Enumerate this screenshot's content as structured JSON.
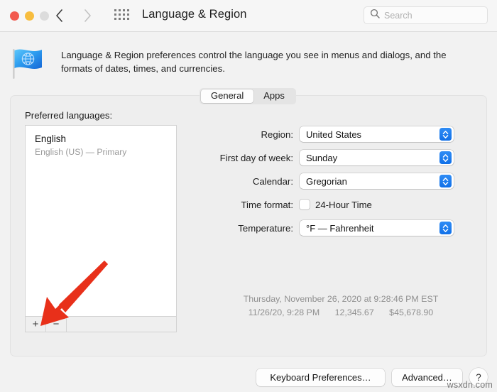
{
  "window": {
    "title": "Language & Region",
    "traffic_lights": [
      "close-red",
      "minimize-yellow",
      "zoom-gray-disabled"
    ],
    "back_icon": "chevron-left-icon",
    "forward_icon": "chevron-right-icon",
    "grid_icon": "show-all-grid-icon"
  },
  "search": {
    "placeholder": "Search",
    "icon": "search-icon",
    "value": ""
  },
  "header": {
    "icon": "flag-globe-icon",
    "description": "Language & Region preferences control the language you see in menus and dialogs, and the formats of dates, times, and currencies."
  },
  "tabs": [
    {
      "label": "General",
      "active": true
    },
    {
      "label": "Apps",
      "active": false
    }
  ],
  "languages": {
    "section_label": "Preferred languages:",
    "items": [
      {
        "name": "English",
        "detail": "English (US) — Primary"
      }
    ],
    "add_button": "+",
    "remove_button": "−"
  },
  "form": {
    "rows": [
      {
        "label": "Region:",
        "type": "popup",
        "value": "United States"
      },
      {
        "label": "First day of week:",
        "type": "popup",
        "value": "Sunday"
      },
      {
        "label": "Calendar:",
        "type": "popup",
        "value": "Gregorian"
      },
      {
        "label": "Time format:",
        "type": "checkbox",
        "value": "24-Hour Time",
        "checked": false
      },
      {
        "label": "Temperature:",
        "type": "popup",
        "value": "°F — Fahrenheit"
      }
    ]
  },
  "preview": {
    "line1": "Thursday, November 26, 2020 at 9:28:46 PM EST",
    "line2_date": "11/26/20, 9:28 PM",
    "line2_number": "12,345.67",
    "line2_currency": "$45,678.90"
  },
  "footer": {
    "keyboard_button": "Keyboard Preferences…",
    "advanced_button": "Advanced…",
    "help_button": "?"
  },
  "annotation": {
    "arrow": "red-arrow-pointing-to-add-language-button",
    "color": "#e8301a"
  },
  "watermark": "wsxdn.com",
  "colors": {
    "accent": "#1070e8",
    "window_bg": "#f2f2f2",
    "panel_bg": "#eeeeee",
    "toolbar_bg": "#f6f6f6"
  }
}
